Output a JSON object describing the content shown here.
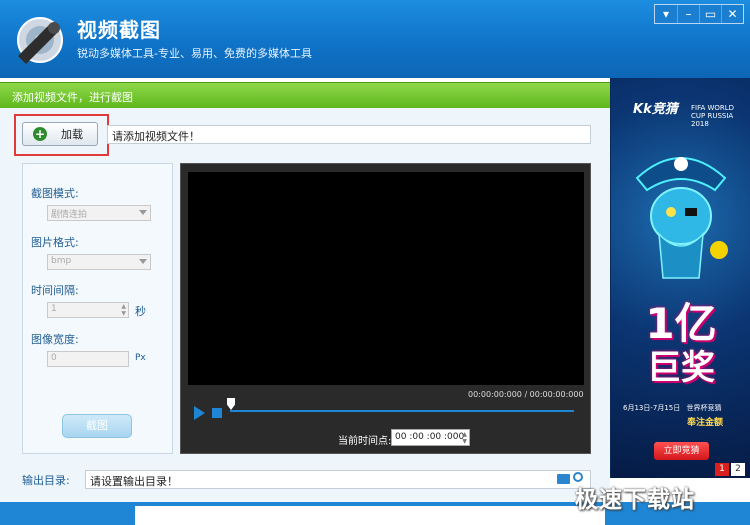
{
  "header": {
    "title": "视频截图",
    "subtitle": "锐动多媒体工具-专业、易用、免费的多媒体工具"
  },
  "window_controls": [
    {
      "name": "menu",
      "glyph": "▾"
    },
    {
      "name": "minimize",
      "glyph": "–"
    },
    {
      "name": "maximize",
      "glyph": "▭"
    },
    {
      "name": "close",
      "glyph": "✕"
    }
  ],
  "banner": {
    "text": "添加视频文件，进行截图"
  },
  "load": {
    "button_label": "加载",
    "file_path": "请添加视频文件！"
  },
  "options": {
    "mode_label": "截图模式:",
    "mode_value": "剧情连拍",
    "format_label": "图片格式:",
    "format_value": "bmp",
    "interval_label": "时间间隔:",
    "interval_value": "1",
    "interval_unit": "秒",
    "width_label": "图像宽度:",
    "width_value": "0",
    "width_unit": "Px",
    "capture_button": "截图"
  },
  "player": {
    "timecode": "00:00:00:000 / 00:00:00:000",
    "current_label": "当前时间点:",
    "current_value": "00 :00 :00 :000",
    "seek_progress": 0
  },
  "output": {
    "label": "输出目录:",
    "path": "请设置输出目录！"
  },
  "ad": {
    "logo": "Kk竞猜",
    "event": "FIFA WORLD CUP RUSSIA 2018",
    "big_line1": "1亿",
    "big_line2": "巨奖",
    "date": "6月13日-7月15日",
    "event_cn": "世界杯竞猜",
    "slogan": "奉注金额",
    "button": "立即竞猜",
    "pages": [
      "1",
      "2"
    ]
  },
  "watermark": "极速下载站",
  "colors": {
    "header_blue": "#0f72c6",
    "accent_green": "#5fb71c",
    "highlight_red": "#e03a3a",
    "player_blue": "#1e86d4"
  }
}
